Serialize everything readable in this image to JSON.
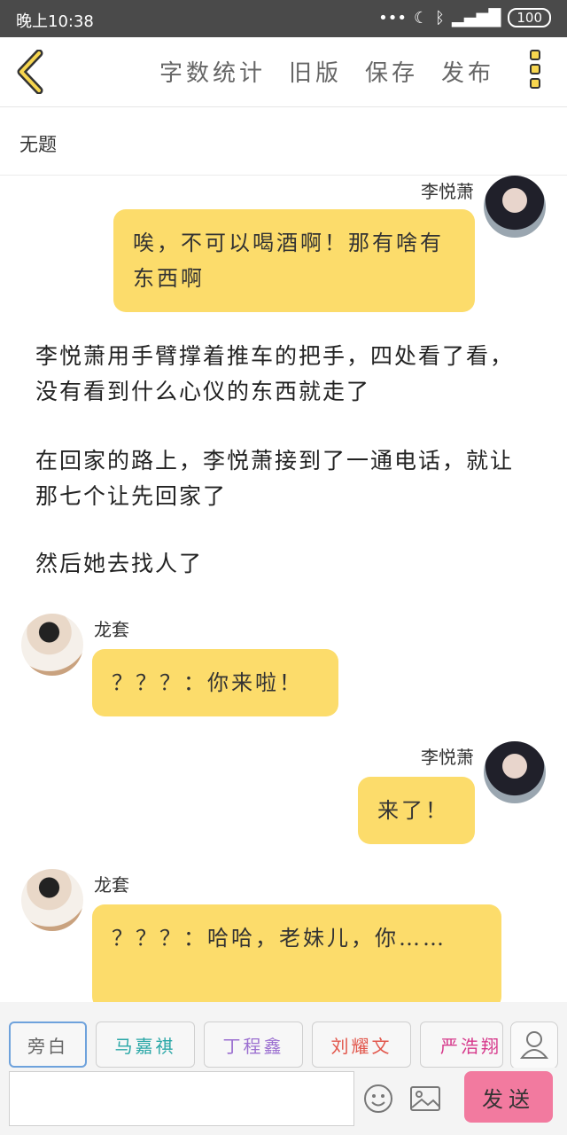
{
  "status": {
    "time": "晚上10:38",
    "battery": "100"
  },
  "toolbar": {
    "word_count": "字数统计",
    "old_version": "旧版",
    "save": "保存",
    "publish": "发布"
  },
  "story": {
    "title": "无题"
  },
  "messages": [
    {
      "speaker": "李悦萧",
      "text": "唉，不可以喝酒啊！那有啥有东西啊"
    },
    {
      "narration": "李悦萧用手臂撑着推车的把手，四处看了看，没有看到什么心仪的东西就走了"
    },
    {
      "narration": "在回家的路上，李悦萧接到了一通电话，就让那七个让先回家了"
    },
    {
      "narration": "然后她去找人了"
    },
    {
      "speaker": "龙套",
      "text": "？？？：你来啦！"
    },
    {
      "speaker": "李悦萧",
      "text": "来了！"
    },
    {
      "speaker": "龙套",
      "text": "？？？：哈哈，老妹儿，你……"
    }
  ],
  "characters": [
    {
      "name": "旁白",
      "color": "#666666"
    },
    {
      "name": "马嘉祺",
      "color": "#2aa7a7"
    },
    {
      "name": "丁程鑫",
      "color": "#9b6fd0"
    },
    {
      "name": "刘耀文",
      "color": "#e2574c"
    },
    {
      "name": "严浩翔",
      "color": "#d6388b"
    }
  ],
  "input": {
    "placeholder": "",
    "send_label": "发送"
  },
  "colors": {
    "bubble": "#fcdc6b",
    "send": "#f27a9f",
    "accent": "#f7d64f"
  }
}
